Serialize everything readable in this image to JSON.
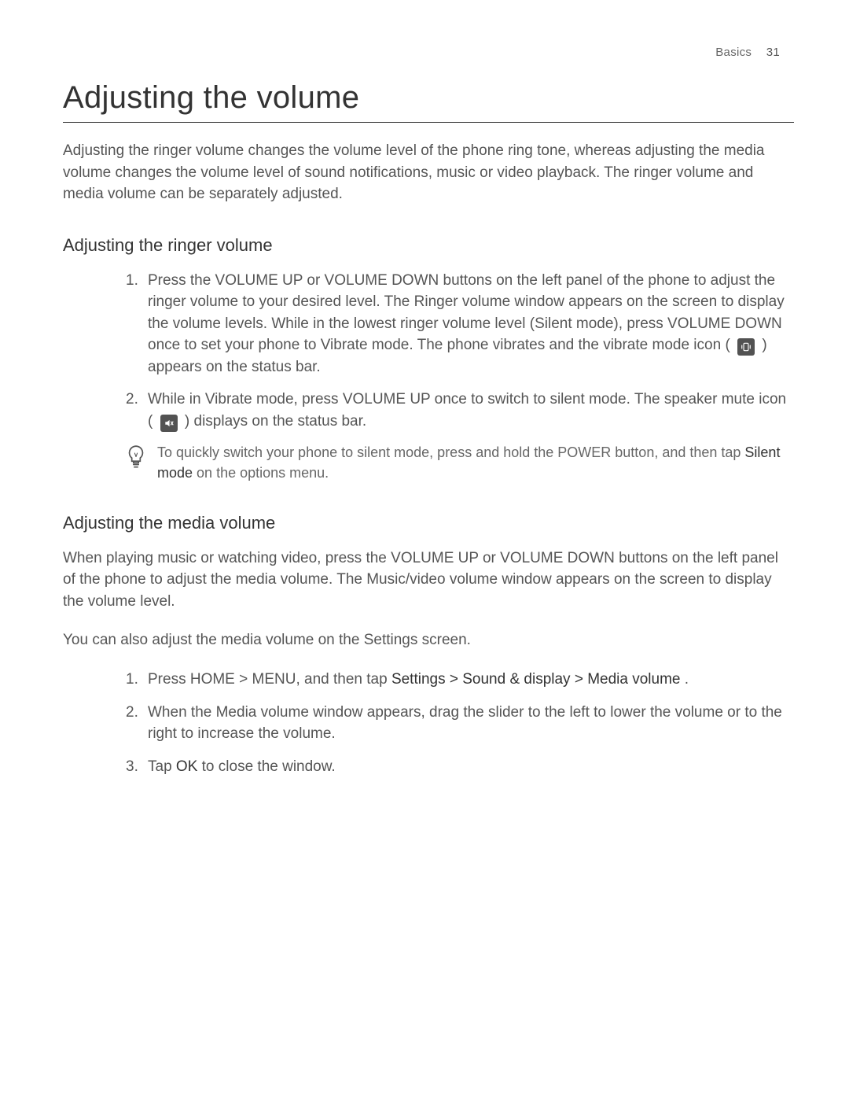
{
  "header": {
    "chapter": "Basics",
    "page_number": "31"
  },
  "title": "Adjusting the volume",
  "intro": "Adjusting the ringer volume changes the volume level of the phone ring tone, whereas adjusting the media volume changes the volume level of sound notifications, music or video playback. The ringer volume and media volume can be separately adjusted.",
  "section1": {
    "heading": "Adjusting the ringer volume",
    "step1_a": "Press the VOLUME UP or VOLUME DOWN buttons on the left panel of the phone to adjust the ringer volume to your desired level. The Ringer volume window appears on the screen to display the volume levels. While in the lowest ringer volume level (Silent mode), press VOLUME DOWN once to set your phone to Vibrate mode. The phone vibrates and the vibrate mode icon ( ",
    "step1_b": " ) appears on the status bar.",
    "step2_a": "While in Vibrate mode, press VOLUME UP once to switch to silent mode. The speaker mute icon ( ",
    "step2_b": " ) displays on the status bar.",
    "tip_a": "To quickly switch your phone to silent mode, press and hold the POWER button, and then tap ",
    "tip_bold": "Silent mode",
    "tip_b": " on the options menu."
  },
  "section2": {
    "heading": "Adjusting the media volume",
    "p1": "When playing music or watching video, press the VOLUME UP or VOLUME DOWN buttons on the left panel of the phone to adjust the media volume. The Music/video volume window appears on the screen to display the volume level.",
    "p2": "You can also adjust the media volume on the Settings screen.",
    "step1_a": "Press HOME > MENU, and then tap ",
    "step1_bold": "Settings > Sound & display > Media volume",
    "step1_b": ".",
    "step2": "When the Media volume window appears, drag the slider to the left to lower the volume or to the right to increase the volume.",
    "step3_a": "Tap ",
    "step3_bold": "OK",
    "step3_b": " to close the window."
  }
}
